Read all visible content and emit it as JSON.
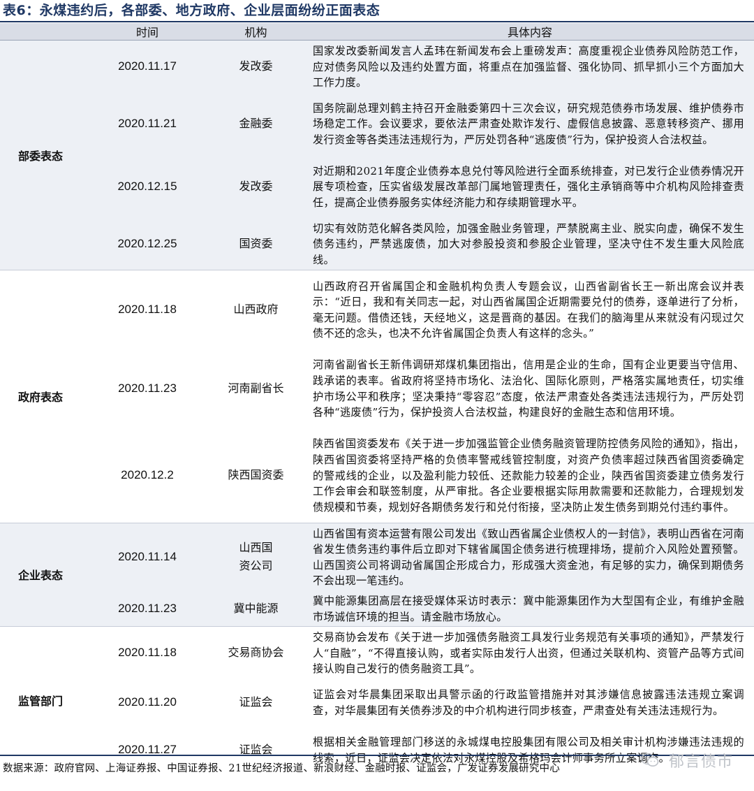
{
  "title": "表6：永煤违约后，各部委、地方政府、企业层面纷纷正面表态",
  "headers": [
    "",
    "时间",
    "机构",
    "具体内容"
  ],
  "groups": [
    {
      "category": "部委表态",
      "rows": [
        {
          "date": "2020.11.17",
          "org": "发改委",
          "content": "国家发改委新闻发言人孟玮在新闻发布会上重磅发声：高度重视企业债券风险防范工作，应对债务风险以及违约处置方面，将重点在加强监督、强化协同、抓早抓小三个方面加大工作力度。"
        },
        {
          "date": "2020.11.21",
          "org": "金融委",
          "content": "国务院副总理刘鹤主持召开金融委第四十三次会议，研究规范债券市场发展、维护债券市场稳定工作。会议要求，要依法严肃查处欺诈发行、虚假信息披露、恶意转移资产、挪用发行资金等各类违法违规行为，严厉处罚各种“逃废债”行为，保护投资人合法权益。"
        },
        {
          "date": "2020.12.15",
          "org": "发改委",
          "content": "对近期和2021年度企业债券本息兑付等风险进行全面系统排查，对已发行企业债券情况开展专项检查，压实省级发展改革部门属地管理责任，强化主承销商等中介机构风险排查责任，提高企业债券服务实体经济能力和存续期管理水平。"
        },
        {
          "date": "2020.12.25",
          "org": "国资委",
          "content": "切实有效防范化解各类风险，加强金融业务管理，严禁脱离主业、脱实向虚，确保不发生债务违约，严禁逃废债，加大对参股投资和参股企业管理，坚决守住不发生重大风险底线。"
        }
      ]
    },
    {
      "category": "政府表态",
      "rows": [
        {
          "date": "2020.11.18",
          "org": "山西政府",
          "content": "山西政府召开省属国企和金融机构负责人专题会议，山西省副省长王一新出席会议并表示：“近日，我和有关同志一起，对山西省属国企近期需要兑付的债券，逐单进行了分析，毫无问题。借债还钱，天经地义，这是晋商的基因。在我们的脑海里从来就没有闪现过欠债不还的念头，也决不允许省属国企负责人有这样的念头。”"
        },
        {
          "date": "2020.11.23",
          "org": "河南副省长",
          "content": "河南省副省长王新伟调研郑煤机集团指出，信用是企业的生命，国有企业更要当守信用、践承诺的表率。省政府将坚持市场化、法治化、国际化原则，严格落实属地责任，切实维护市场公平和秩序；坚决秉持“零容忍”态度，依法严肃查处各类违法违规行为，严厉处罚各种“逃废债”行为，保护投资人合法权益，构建良好的金融生态和信用环境。"
        },
        {
          "date": "2020.12.2",
          "org": "陕西国资委",
          "content": "陕西省国资委发布《关于进一步加强监管企业债务融资管理防控债务风险的通知》，指出，陕西省国资委将坚持严格的负债率警戒线管控制度，对资产负债率超过陕西省国资委确定的警戒线的企业，以及盈利能力较低、还款能力较差的企业，陕西省国资委建立债务发行工作会审会和联签制度，从严审批。各企业要根据实际用款需要和还款能力，合理规划发债规模和节奏，规划好各期债务发行和兑付衔接，坚决防止发生债务到期兑付违约事件。"
        }
      ]
    },
    {
      "category": "企业表态",
      "rows": [
        {
          "date": "2020.11.14",
          "org": "山西国资公司",
          "content": "山西省国有资本运营有限公司发出《致山西省属企业债权人的一封信》，表明山西省在河南省发生债务违约事件后立即对下辖省属国企债务进行梳理排场，提前介入风险处置预警。山西国资公司将调动省属国企形成合力，形成强大资金池，有足够的实力，确保到期债务不会出现一笔违约。"
        },
        {
          "date": "2020.11.23",
          "org": "冀中能源",
          "content": "冀中能源集团高层在接受媒体采访时表示：冀中能源集团作为大型国有企业，有维护金融市场诚信环境的担当。请金融市场放心。"
        }
      ]
    },
    {
      "category": "监管部门",
      "rows": [
        {
          "date": "2020.11.18",
          "org": "交易商协会",
          "content": "交易商协会发布《关于进一步加强债务融资工具发行业务规范有关事项的通知》，严禁发行人“自融”，“不得直接认购，或者实际由发行人出资，但通过关联机构、资管产品等方式间接认购自己发行的债务融资工具”。"
        },
        {
          "date": "2020.11.20",
          "org": "证监会",
          "content": "证监会对华晨集团采取出具警示函的行政监管措施并对其涉嫌信息披露违法违规立案调查，对华晨集团有关债券涉及的中介机构进行同步核查，严肃查处有关违法违规行为。"
        },
        {
          "date": "2020.11.27",
          "org": "证监会",
          "content": "根据相关金融管理部门移送的永城煤电控股集团有限公司及相关审计机构涉嫌违法违规的线索，近日，证监会决定依法对永煤控股及希格玛会计师事务所立案调查。"
        }
      ]
    }
  ],
  "source": "数据来源：政府官网、上海证券报、中国证券报、21世纪经济报道、新浪财经、金融时报、证监会，广发证券发展研究中心",
  "watermark": "郁言债市"
}
